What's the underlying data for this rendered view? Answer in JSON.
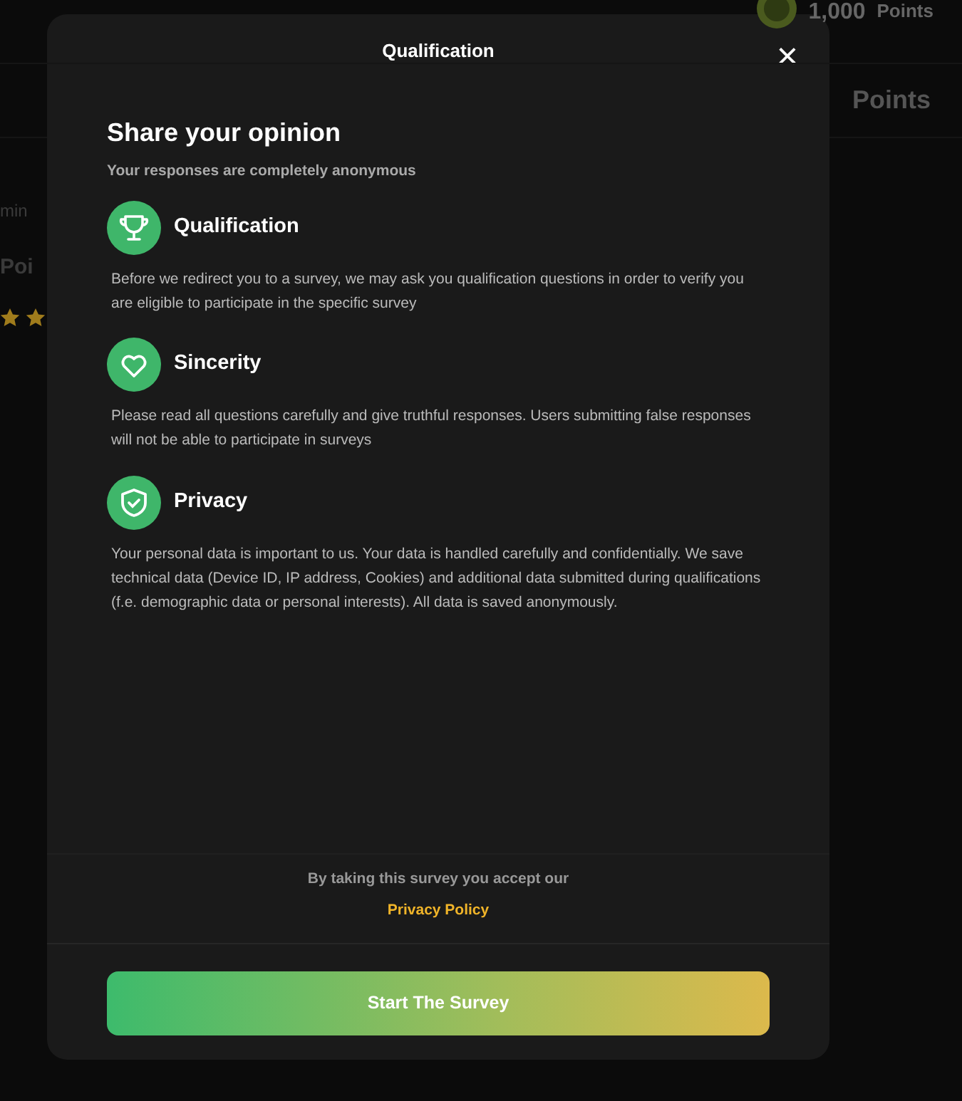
{
  "background": {
    "balance": {
      "amount": "1,000",
      "unit": "Points"
    },
    "tab_label": "Points",
    "left_texts": [
      "min",
      "Poi"
    ]
  },
  "dialog": {
    "title": "Qualification",
    "close": "×",
    "heading": "Share your opinion",
    "subheading": "Your responses are completely anonymous",
    "sections": [
      {
        "kind": "trophy",
        "title": "Qualification",
        "text": "Before we redirect you to a survey, we may ask you qualification questions in order to verify you are eligible to participate in the specific survey"
      },
      {
        "kind": "heart",
        "title": "Sincerity",
        "text": "Please read all questions carefully and give truthful responses. Users submitting false responses will not be able to participate in surveys"
      },
      {
        "kind": "shield",
        "title": "Privacy",
        "text": "Your personal data is important to us. Your data is handled carefully and confidentially. We save technical data (Device ID, IP address, Cookies) and additional data submitted during qualifications (f.e. demographic data or personal interests). All data is saved anonymously."
      }
    ],
    "consent": "By taking this survey you accept our",
    "policy_link": "Privacy Policy",
    "button": "Start The Survey"
  }
}
